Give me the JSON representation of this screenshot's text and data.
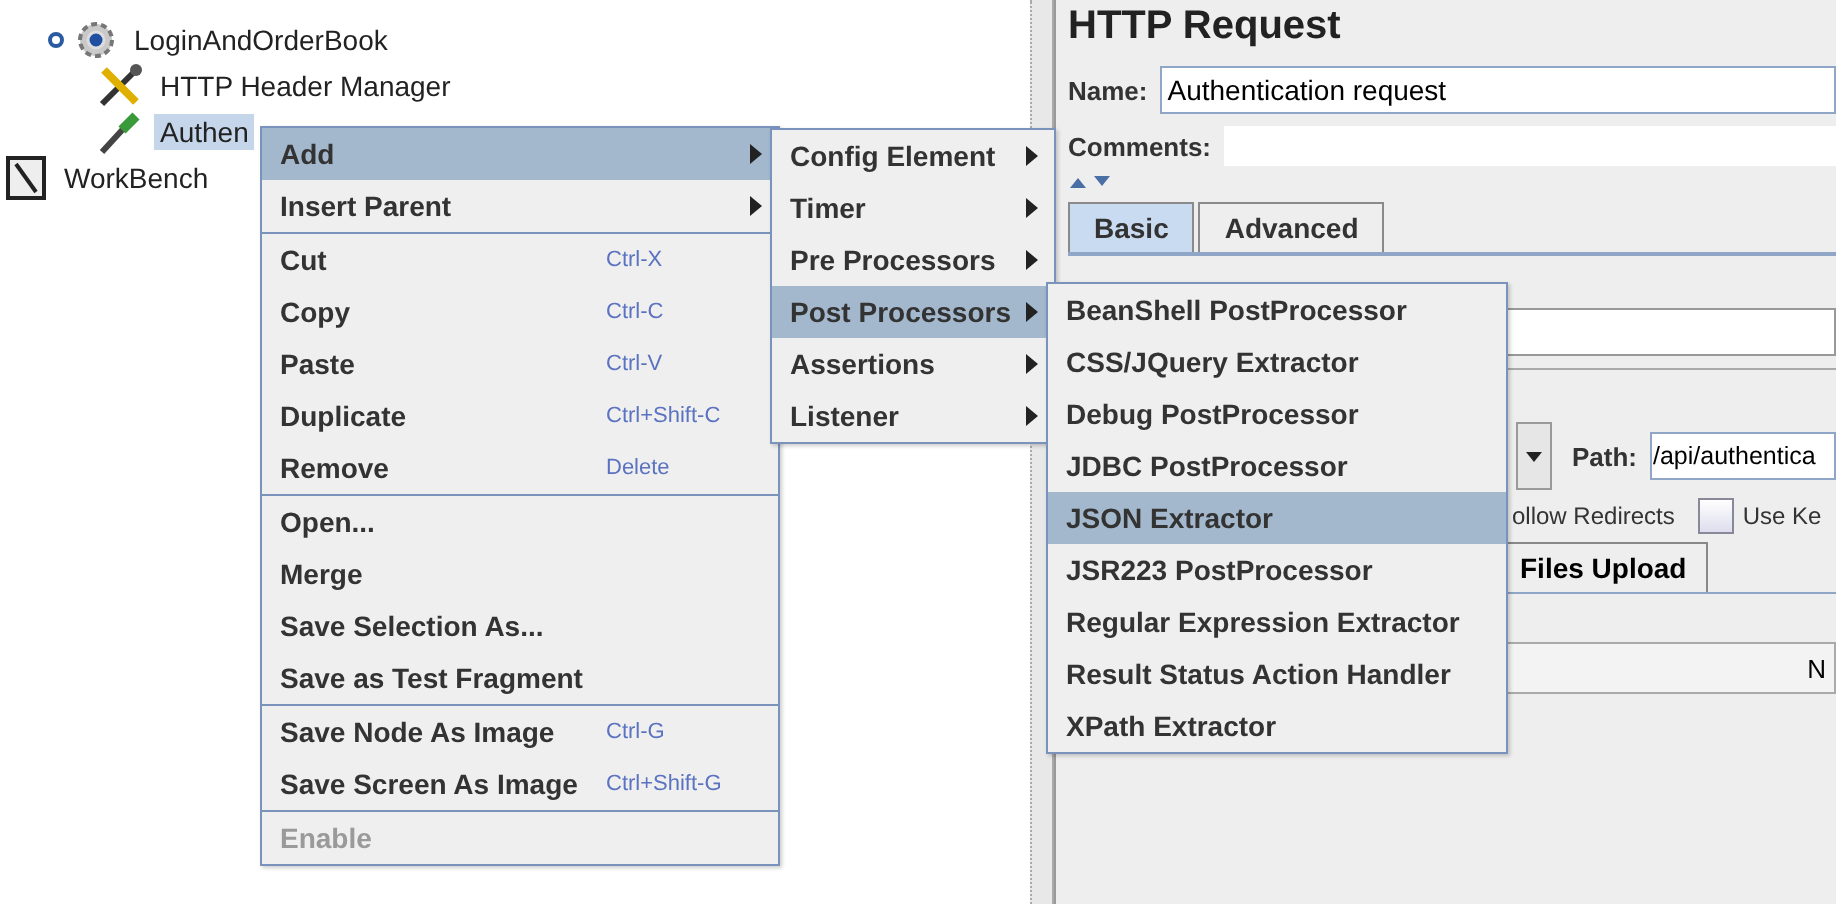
{
  "tree": [
    {
      "label": "LoginAndOrderBook",
      "kind": "gear",
      "expanded": true,
      "selected": false,
      "children": [
        {
          "label": "HTTP Header Manager",
          "kind": "tools",
          "selected": false
        },
        {
          "label": "Authen",
          "kind": "dropper",
          "selected": true
        }
      ]
    },
    {
      "label": "WorkBench",
      "kind": "notebook",
      "selected": false
    }
  ],
  "editor": {
    "title": "HTTP Request",
    "name_label": "Name:",
    "name_value": "Authentication request",
    "comments_label": "Comments:",
    "tabs": [
      {
        "label": "Basic",
        "selected": true
      },
      {
        "label": "Advanced",
        "selected": false
      }
    ],
    "path_label": "Path:",
    "path_value": "/api/authentica",
    "redirect_label": "ollow Redirects",
    "keepalive": {
      "label": "Use Ke",
      "checked": false
    },
    "lower_tab": "Files Upload",
    "table_column": "N"
  },
  "context_menu": {
    "groups": [
      [
        {
          "label": "Add",
          "has_submenu": true,
          "selected": true,
          "disabled": false
        },
        {
          "label": "Insert Parent",
          "has_submenu": true,
          "selected": false,
          "disabled": false
        }
      ],
      [
        {
          "label": "Cut",
          "shortcut": "Ctrl-X",
          "has_submenu": false,
          "selected": false,
          "disabled": false
        },
        {
          "label": "Copy",
          "shortcut": "Ctrl-C",
          "has_submenu": false,
          "selected": false,
          "disabled": false
        },
        {
          "label": "Paste",
          "shortcut": "Ctrl-V",
          "has_submenu": false,
          "selected": false,
          "disabled": false
        },
        {
          "label": "Duplicate",
          "shortcut": "Ctrl+Shift-C",
          "has_submenu": false,
          "selected": false,
          "disabled": false
        },
        {
          "label": "Remove",
          "shortcut": "Delete",
          "has_submenu": false,
          "selected": false,
          "disabled": false
        }
      ],
      [
        {
          "label": "Open...",
          "has_submenu": false,
          "selected": false,
          "disabled": false
        },
        {
          "label": "Merge",
          "has_submenu": false,
          "selected": false,
          "disabled": false
        },
        {
          "label": "Save Selection As...",
          "has_submenu": false,
          "selected": false,
          "disabled": false
        },
        {
          "label": "Save as Test Fragment",
          "has_submenu": false,
          "selected": false,
          "disabled": false
        }
      ],
      [
        {
          "label": "Save Node As Image",
          "shortcut": "Ctrl-G",
          "has_submenu": false,
          "selected": false,
          "disabled": false
        },
        {
          "label": "Save Screen As Image",
          "shortcut": "Ctrl+Shift-G",
          "has_submenu": false,
          "selected": false,
          "disabled": false
        }
      ],
      [
        {
          "label": "Enable",
          "has_submenu": false,
          "selected": false,
          "disabled": true
        }
      ]
    ]
  },
  "add_submenu": {
    "items": [
      {
        "label": "Config Element",
        "has_submenu": true,
        "selected": false
      },
      {
        "label": "Timer",
        "has_submenu": true,
        "selected": false
      },
      {
        "label": "Pre Processors",
        "has_submenu": true,
        "selected": false
      },
      {
        "label": "Post Processors",
        "has_submenu": true,
        "selected": true
      },
      {
        "label": "Assertions",
        "has_submenu": true,
        "selected": false
      },
      {
        "label": "Listener",
        "has_submenu": true,
        "selected": false
      }
    ]
  },
  "post_processors_submenu": {
    "items": [
      {
        "label": "BeanShell PostProcessor",
        "selected": false
      },
      {
        "label": "CSS/JQuery Extractor",
        "selected": false
      },
      {
        "label": "Debug PostProcessor",
        "selected": false
      },
      {
        "label": "JDBC PostProcessor",
        "selected": false
      },
      {
        "label": "JSON Extractor",
        "selected": true
      },
      {
        "label": "JSR223 PostProcessor",
        "selected": false
      },
      {
        "label": "Regular Expression Extractor",
        "selected": false
      },
      {
        "label": "Result Status Action Handler",
        "selected": false
      },
      {
        "label": "XPath Extractor",
        "selected": false
      }
    ]
  }
}
